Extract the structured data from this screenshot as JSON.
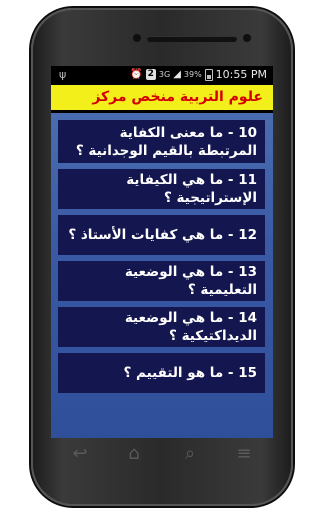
{
  "status_bar": {
    "usb_icon": "usb-icon",
    "alarm_icon": "alarm-icon",
    "notification_badge": "2",
    "signal_label": "3G",
    "battery_percent": "39%",
    "time": "10:55 PM"
  },
  "header": {
    "title": "علوم التربية منخص مركز"
  },
  "list": {
    "items": [
      {
        "text": "10 - ما معنى الكفاية المرتبطة بالقيم الوجدانية ؟"
      },
      {
        "text": "11 - ما هي الكيفاية الإستراتيجية ؟"
      },
      {
        "text": "12 - ما هي كفايات الأستاذ ؟"
      },
      {
        "text": "13 - ما هي الوضعية التعليمية ؟"
      },
      {
        "text": "14 - ما هي الوضعية الديداكتيكية ؟"
      },
      {
        "text": "15 - ما هو التقييم ؟"
      }
    ]
  },
  "nav_bar": {
    "icons": [
      "back-icon",
      "home-icon",
      "search-icon",
      "menu-icon"
    ]
  }
}
